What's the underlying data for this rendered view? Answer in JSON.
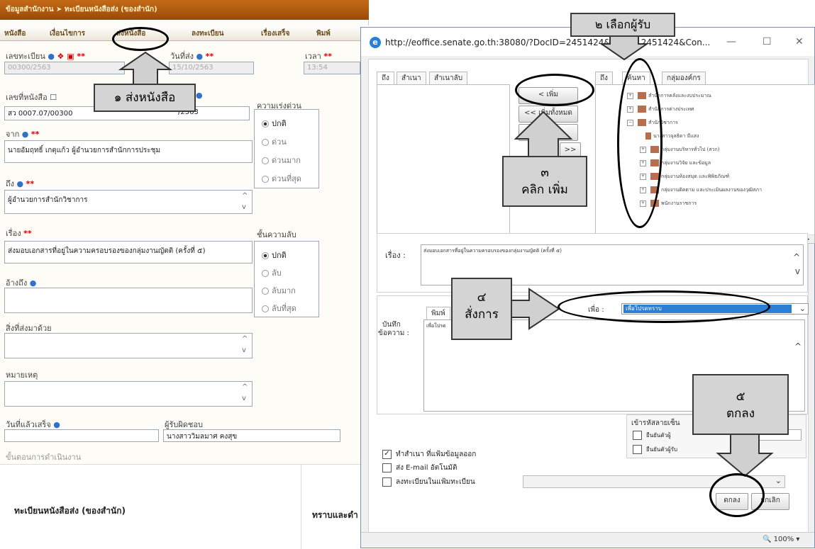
{
  "left_form": {
    "title_bar": "ข้อมูลสำนักงาน ➤ ทะเบียนหนังสือส่ง (ของสำนัก)",
    "tabs": [
      "หนังสือ",
      "เงื่อนไขการ",
      "ส่งหนังสือ",
      "ลงทะเบียน",
      "เรื่องเสร็จ",
      "พิมพ์"
    ],
    "reg_no_label": "เลขทะเบียน",
    "reg_no_value": "00300/2563",
    "send_date_label": "วันที่ส่ง",
    "send_date_value": "15/10/2563",
    "time_label": "เวลา",
    "time_value": "13:54",
    "doc_no_label": "เลขที่หนังสือ",
    "doc_no_value": "สว 0007.07/00300",
    "doc_date_value": "/2563",
    "urgency_label": "ความเร่งด่วน",
    "urgency_options": [
      "ปกติ",
      "ด่วน",
      "ด่วนมาก",
      "ด่วนที่สุด"
    ],
    "from_label": "จาก",
    "from_value": "นายอัมฤทธิ์ เกตุแก้ว ผู้อำนวยการสำนักการประชุม",
    "to_label": "ถึง",
    "to_value": "ผู้อำนวยการสำนักวิชาการ",
    "subject_label": "เรื่อง",
    "subject_value": "ส่งมอบเอกสารที่อยู่ในความครอบรองของกลุ่มงานญัตติ (ครั้งที่ ๕)",
    "secrecy_label": "ชั้นความลับ",
    "secrecy_options": [
      "ปกติ",
      "ลับ",
      "ลับมาก",
      "ลับที่สุด"
    ],
    "ref_label": "อ้างถึง",
    "attach_label": "สิ่งที่ส่งมาด้วย",
    "note_label": "หมายเหตุ",
    "done_date_label": "วันที่แล้วเสร็จ",
    "owner_label": "ผู้รับผิดชอบ",
    "owner_value": "นางสาววิมลมาศ คงสุข",
    "steps_label": "ขั้นตอนการดำเนินงาน",
    "section_title": "ทะเบียนหนังสือส่ง (ของสำนัก)",
    "section_right": "ทราบและดำ"
  },
  "popup": {
    "url": "http://eoffice.senate.go.th:38080/?DocID=2451424&Conte",
    "url_tail": "2451424&Con...",
    "to_tabs": [
      "ถึง",
      "สำเนา",
      "สำเนาลับ"
    ],
    "add_button": "< เพิ่ม",
    "add_all_button": "<< เพิ่มทั้งหมด",
    "remove_short": "ล",
    "forward_button": ">>",
    "org_tabs": [
      "ถึง",
      "ค้นหา",
      "กลุ่มองค์กร"
    ],
    "tree_items": [
      "สำนักการคลังและงบประมาณ",
      "สำนักการต่างประเทศ",
      "สำนักวิชาการ",
      "นางสาวจุลธิดา มีแสง",
      "กลุ่มงานบริหารทั่วไป (สวก)",
      "กลุ่มงานวิจัย และข้อมูล",
      "กลุ่มงานห้องสมุด และพิพิธภัณฑ์",
      "กลุ่มงานติดตาม และประเมินผลงานของวุฒิสภา",
      "พนักงานราชการ"
    ],
    "subject_label": "เรื่อง :",
    "subject_value": "ส่งมอบเอกสารที่อยู่ในความครอบรองของกลุ่มงานญัตติ (ครั้งที่ ๕)",
    "memo_label_1": "บันทึก",
    "memo_label_2": "ข้อความ :",
    "memo_tab": "พิมพ์",
    "memo_value": "เพื่อโปรด",
    "purpose_label": "เพื่อ :",
    "purpose_value": "เพื่อโปรดทราบ",
    "encrypt_label": "เข้ารหัสลายเซ็น",
    "encrypt_opt1": "ยืนยันตัวผู้",
    "encrypt_opt2": "ยืนยันตัวผู้รับ",
    "check_copy": "ทำสำเนา ที่แฟ้มข้อมูลออก",
    "check_email": "ส่ง E-mail อัตโนมัติ",
    "check_register": "ลงทะเบียนในแฟ้มทะเบียน",
    "ok_button": "ตกลง",
    "cancel_button": "ยกเลิก",
    "zoom": "100%"
  },
  "callouts": {
    "c1": "๑ ส่งหนังสือ",
    "c2": "๒ เลือกผู้รับ",
    "c3_num": "๓",
    "c3_text": "คลิก เพิ่ม",
    "c4_num": "๔",
    "c4_text": "สั่งการ",
    "c5_num": "๕",
    "c5_text": "ตกลง"
  }
}
